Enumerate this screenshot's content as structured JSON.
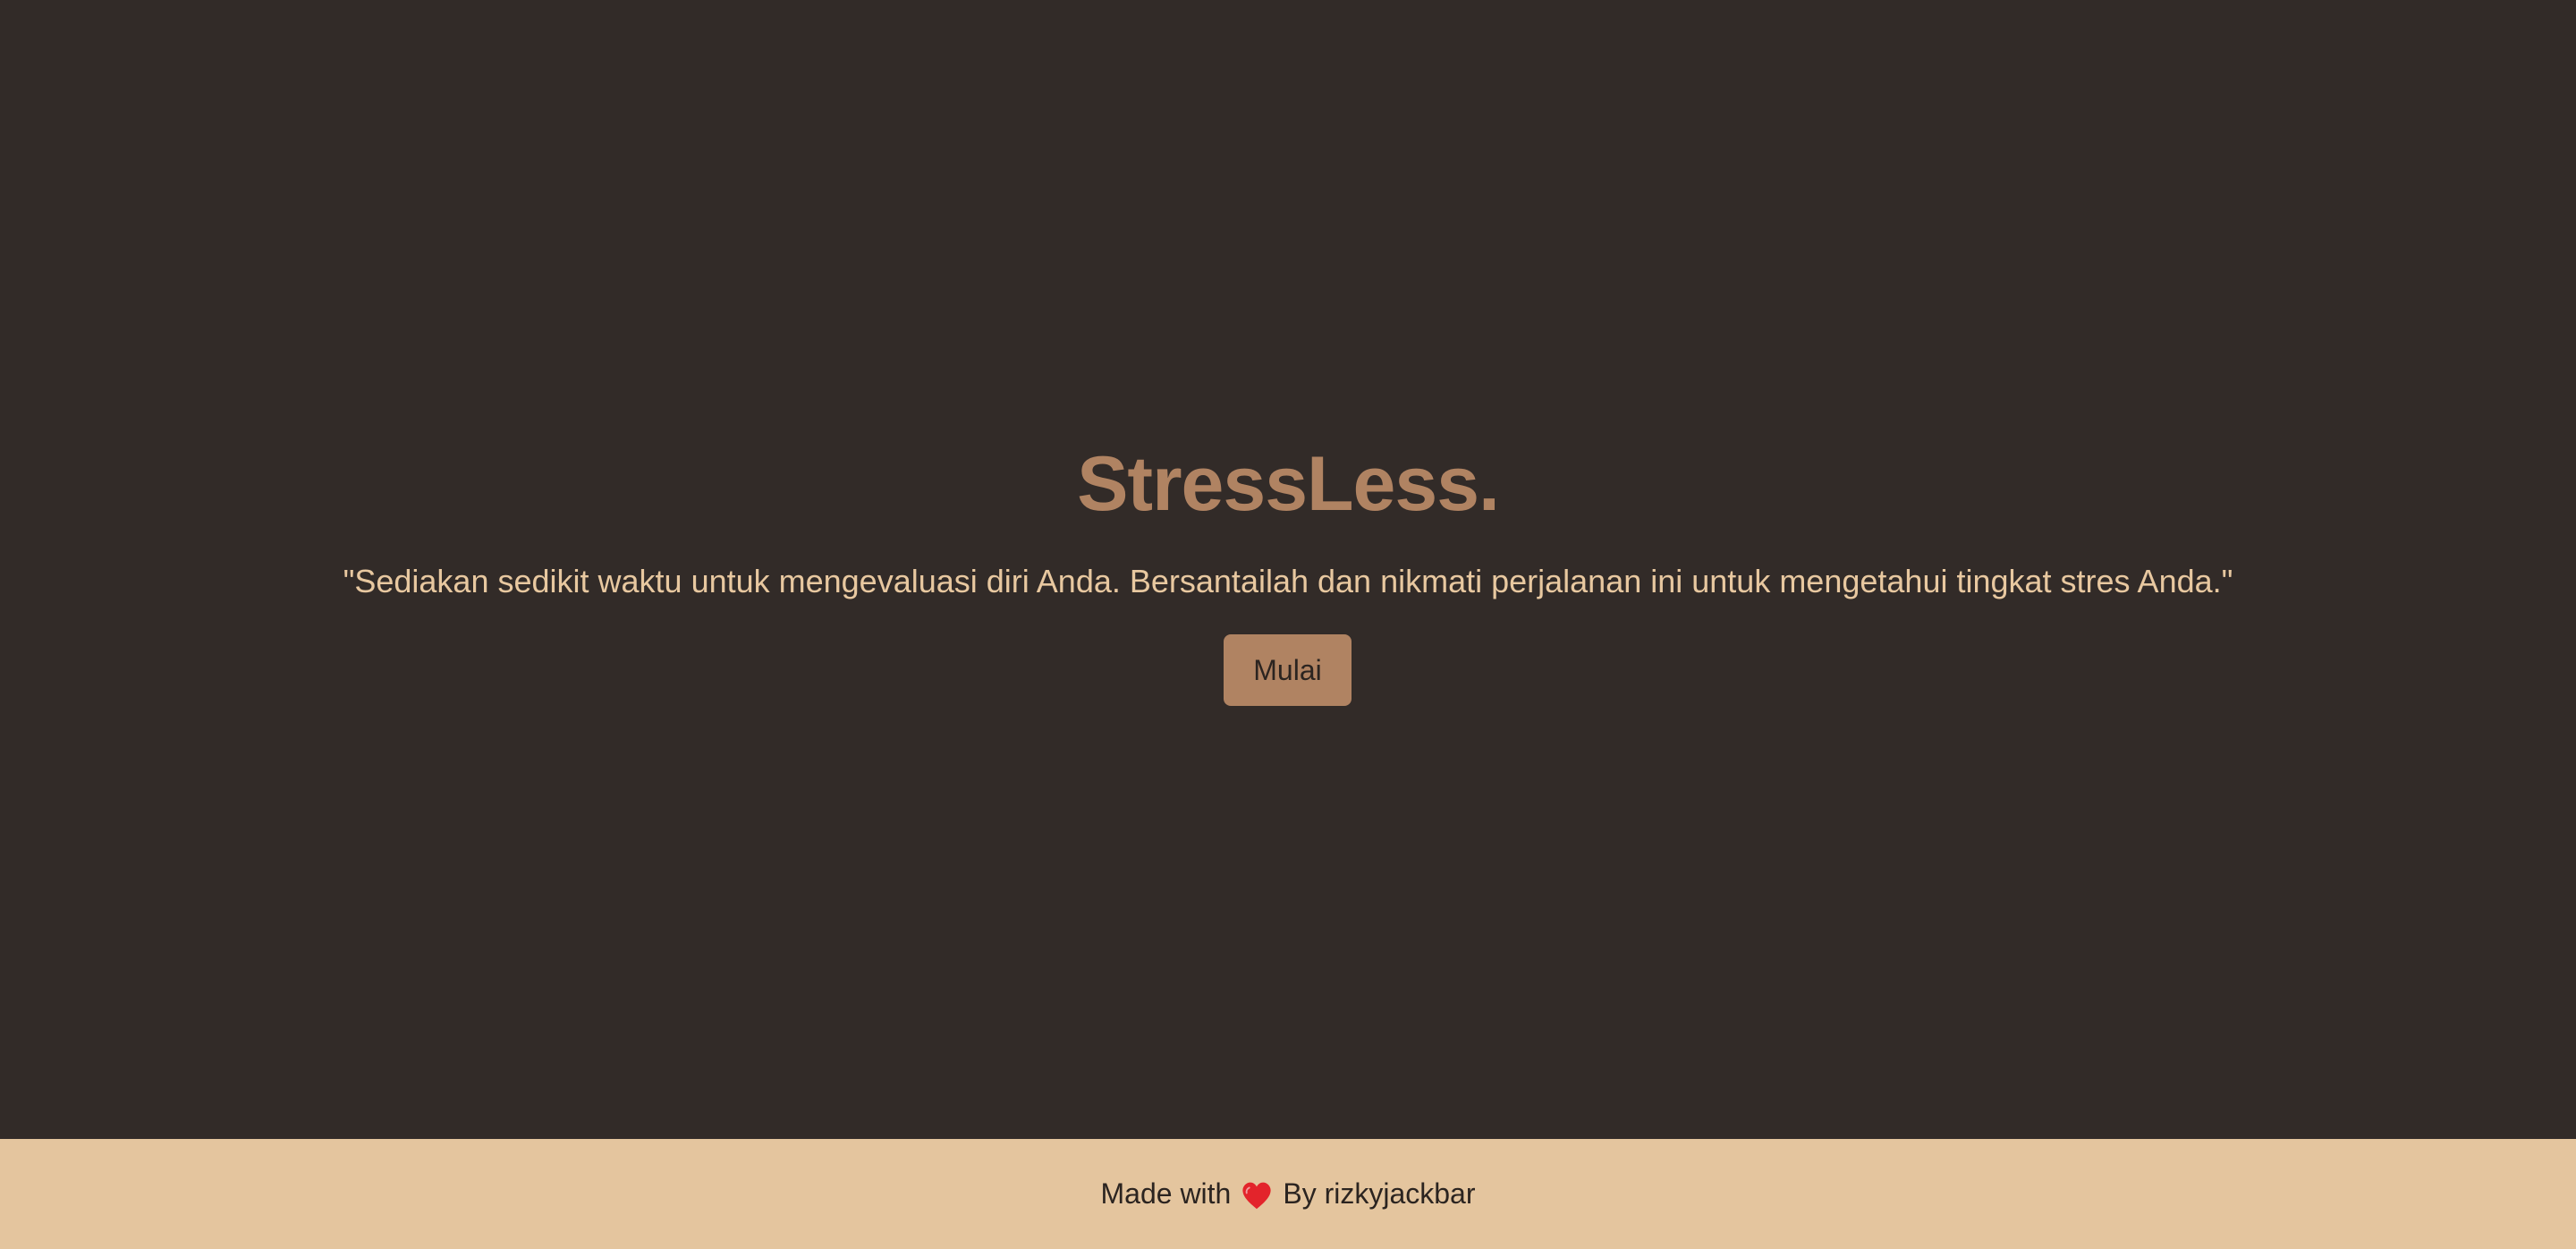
{
  "app": {
    "title": "StressLess.",
    "quote": "\"Sediakan sedikit waktu untuk mengevaluasi diri Anda. Bersantailah dan nikmati perjalanan ini untuk mengetahui tingkat stres Anda.\"",
    "start_button_label": "Mulai"
  },
  "footer": {
    "made_with_label": "Made with",
    "heart_icon": "heart-icon",
    "by_label": "By rizkyjackbar"
  },
  "colors": {
    "background": "#322b28",
    "accent": "#b08362",
    "quote_text": "#e8c8a0",
    "button_text": "#2b2420",
    "footer_background": "#e4c59e",
    "footer_text": "#2b2420",
    "heart": "#e3242b"
  }
}
